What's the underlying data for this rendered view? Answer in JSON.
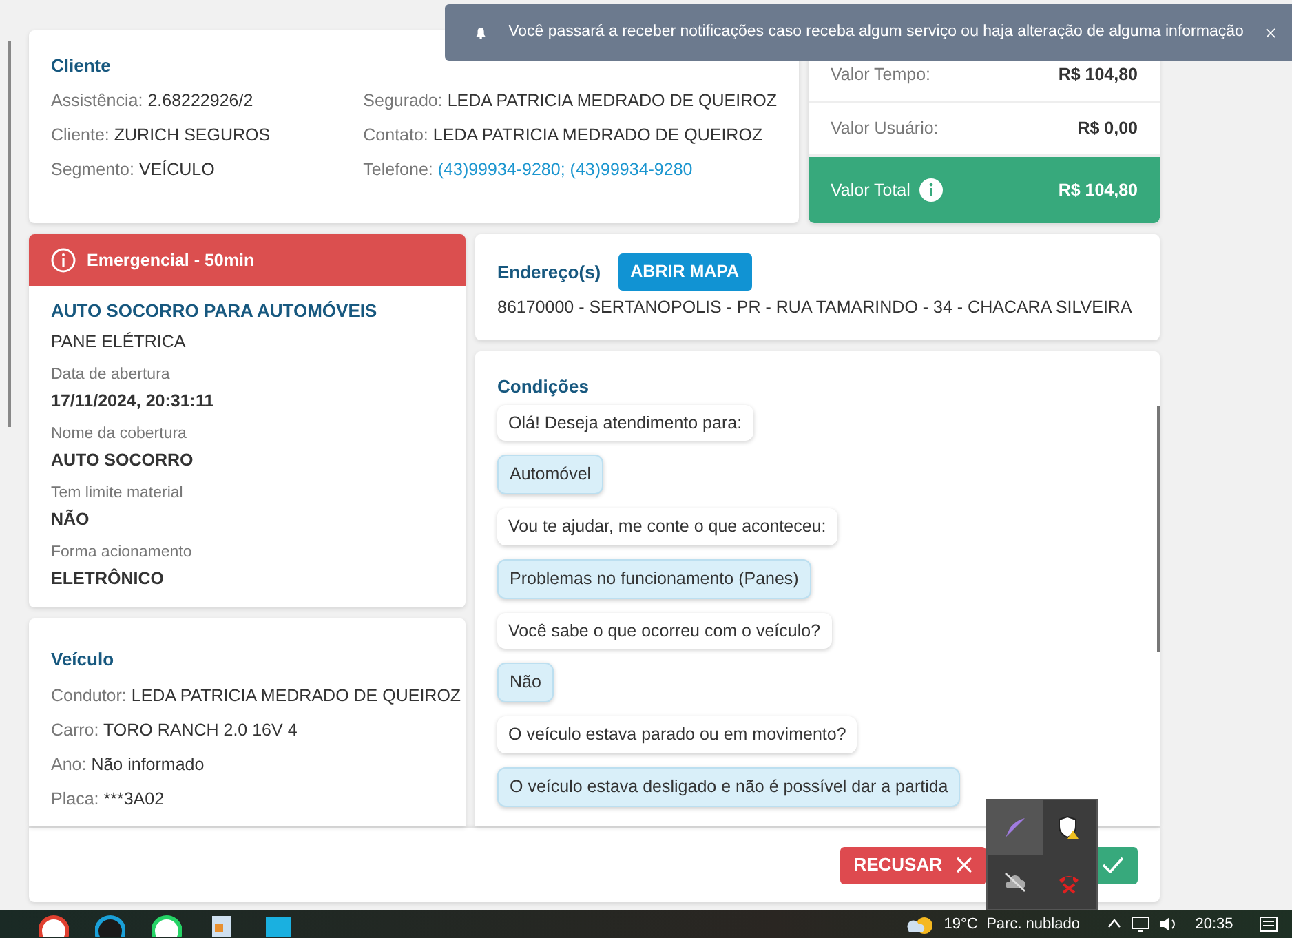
{
  "notification": {
    "text": "Você passará a receber notificações caso receba algum serviço ou haja alteração de alguma informação"
  },
  "cliente": {
    "title": "Cliente",
    "fields_left": [
      {
        "label": "Assistência:",
        "value": "2.68222926/2"
      },
      {
        "label": "Cliente:",
        "value": "ZURICH SEGUROS"
      },
      {
        "label": "Segmento:",
        "value": "VEÍCULO"
      }
    ],
    "fields_right": [
      {
        "label": "Segurado:",
        "value": "LEDA PATRICIA MEDRADO DE QUEIROZ",
        "kind": "text"
      },
      {
        "label": "Contato:",
        "value": "LEDA PATRICIA MEDRADO DE QUEIROZ",
        "kind": "text"
      },
      {
        "label": "Telefone:",
        "value": "(43)99934-9280; (43)99934-9280",
        "kind": "link"
      }
    ]
  },
  "valores": {
    "rows": [
      {
        "label": "Valor Tempo:",
        "value": "R$ 104,80"
      },
      {
        "label": "Valor Usuário:",
        "value": "R$ 0,00"
      }
    ],
    "total": {
      "label": "Valor Total",
      "value": "R$ 104,80"
    }
  },
  "servico": {
    "badge": "Emergencial - 50min",
    "title": "AUTO SOCORRO PARA AUTOMÓVEIS",
    "problem": "PANE ELÉTRICA",
    "details": [
      {
        "label": "Data de abertura",
        "value": "17/11/2024, 20:31:11"
      },
      {
        "label": "Nome da cobertura",
        "value": "AUTO SOCORRO"
      },
      {
        "label": "Tem limite material",
        "value": "NÃO"
      },
      {
        "label": "Forma acionamento",
        "value": "ELETRÔNICO"
      }
    ]
  },
  "veiculo": {
    "title": "Veículo",
    "fields": [
      {
        "label": "Condutor:",
        "value": "LEDA PATRICIA MEDRADO DE QUEIROZ"
      },
      {
        "label": "Carro:",
        "value": "TORO RANCH 2.0 16V 4"
      },
      {
        "label": "Ano:",
        "value": "Não informado"
      },
      {
        "label": "Placa:",
        "value": "***3A02"
      }
    ]
  },
  "endereco": {
    "title": "Endereço(s)",
    "button": "ABRIR MAPA",
    "address": "86170000 - SERTANOPOLIS - PR - RUA TAMARINDO - 34 - CHACARA SILVEIRA"
  },
  "condicoes": {
    "title": "Condições",
    "messages": [
      {
        "text": "Olá! Deseja atendimento para:",
        "kind": "question"
      },
      {
        "text": "Automóvel",
        "kind": "answer"
      },
      {
        "text": "Vou te ajudar, me conte o que aconteceu:",
        "kind": "question"
      },
      {
        "text": "Problemas no funcionamento (Panes)",
        "kind": "answer"
      },
      {
        "text": "Você sabe o que ocorreu com o veículo?",
        "kind": "question"
      },
      {
        "text": "Não",
        "kind": "answer"
      },
      {
        "text": "O veículo estava parado ou em movimento?",
        "kind": "question"
      },
      {
        "text": "O veículo estava desligado e não é possível dar a partida",
        "kind": "answer"
      }
    ]
  },
  "actions": {
    "reject": "RECUSAR"
  },
  "taskbar": {
    "weather_temp": "19°C",
    "weather_text": "Parc. nublado",
    "clock": "20:35"
  }
}
